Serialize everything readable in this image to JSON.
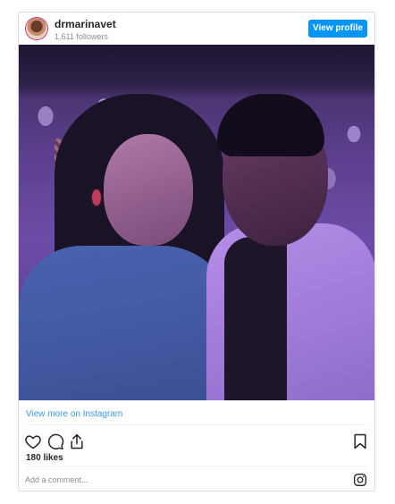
{
  "profile": {
    "username": "drmarinavet",
    "followers": "1,611 followers",
    "view_profile_label": "View profile"
  },
  "post": {
    "view_more_label": "View more on Instagram",
    "likes": "180 likes",
    "comment_placeholder": "Add a comment..."
  },
  "icons": {
    "like": "heart-icon",
    "comment": "comment-icon",
    "share": "share-icon",
    "save": "bookmark-icon",
    "instagram": "instagram-icon"
  },
  "colors": {
    "accent": "#0095f6",
    "link": "#3897f0"
  }
}
